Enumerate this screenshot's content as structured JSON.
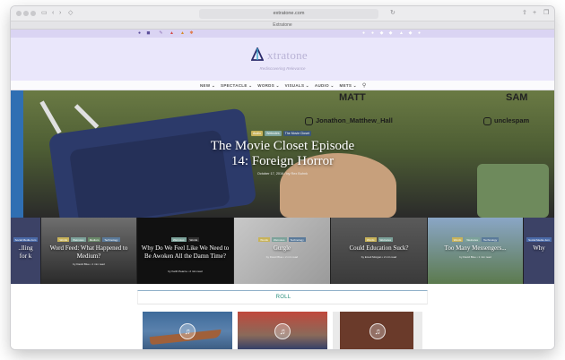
{
  "browser": {
    "url": "extratone.com",
    "tab_title": "Extratone",
    "toolbar_icons": [
      "sidebar-icon",
      "back-icon",
      "forward-icon",
      "shield-icon",
      "share-icon",
      "new-tab-icon",
      "tabs-overview-icon"
    ]
  },
  "admin_bar": {
    "left_icons": [
      "dashboard-icon",
      "site-icon",
      "customize-icon",
      "updates-icon",
      "comments-icon",
      "new-icon"
    ],
    "right_icons": [
      "bell-icon",
      "user-icon",
      "star-icon",
      "gear-icon",
      "link-icon",
      "search-icon",
      "profile-icon"
    ]
  },
  "site": {
    "brand": "xtratone",
    "tagline": "Rediscovering Relevance",
    "colors": {
      "header_bg": "#eae7fb",
      "accent": "#2c8f7e",
      "admin_bar": "#dad4f3"
    }
  },
  "nav": {
    "items": [
      "NEW ⌄",
      "SPECTACLE ⌄",
      "WORDS ⌄",
      "VISUALS ⌄",
      "AUDIO ⌄",
      "METS ⌄"
    ],
    "search_icon": "search-icon"
  },
  "hero": {
    "tags": [
      "Audio",
      "Wetnotes",
      "The Movie Closet"
    ],
    "title_line1": "The Movie Closet Episode",
    "title_line2": "14: Foreign Horror",
    "meta": "October 17, 2016 / by Rex Buhnk",
    "sign_left": "MATT",
    "sign_right": "SAM",
    "handle_left": "Jonathon_Matthew_Hall",
    "handle_right": "unclespam"
  },
  "strip": [
    {
      "tags": [
        "Social Media Jum"
      ],
      "title": "..lling for k",
      "meta": ""
    },
    {
      "tags": [
        "Words",
        "Wetnotes",
        "Medium",
        "Technology"
      ],
      "title": "Word Feed: What Happened to Medium?",
      "meta": "by David Blue • 1 min read"
    },
    {
      "tags": [
        "Wetnotes",
        "Words"
      ],
      "title": "Why Do We Feel Like We Need to Be Awoken All the Damn Time?",
      "meta": "by Keith Pearce • 2 min read"
    },
    {
      "tags": [
        "Words",
        "Wetnotes",
        "Technology"
      ],
      "title": "Gurgle",
      "meta": "by David Blue • 2 min read"
    },
    {
      "tags": [
        "Words",
        "Wetnotes"
      ],
      "title": "Could Education Suck?",
      "meta": "by Emeli Morgan • 2 min read"
    },
    {
      "tags": [
        "Words",
        "Wetnotes",
        "Technology"
      ],
      "title": "Too Many Messengers...",
      "meta": "by David Blue • 1 min read"
    },
    {
      "tags": [
        "Social Media Jum"
      ],
      "title": "Why",
      "meta": ""
    }
  ],
  "roll": {
    "label": "ROLL",
    "thumbs": [
      "music-icon",
      "music-icon",
      "music-icon"
    ]
  }
}
